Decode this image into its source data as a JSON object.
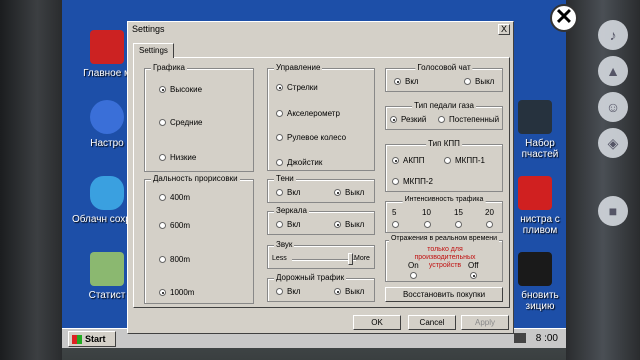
{
  "desktop_icons": [
    {
      "name": "home-icon",
      "label": "Главное м",
      "color": "#cc2222"
    },
    {
      "name": "settings-icon",
      "label": "Настро",
      "color": "#3a6fd8"
    },
    {
      "name": "cloud-save-icon",
      "label": "Облачн сохране",
      "color": "#3aa0e0"
    },
    {
      "name": "stats-icon",
      "label": "Статист",
      "color": "#8bb870"
    }
  ],
  "desktop_icons_right": [
    {
      "name": "parts-icon",
      "label": "Набор пчастей"
    },
    {
      "name": "fuel-icon",
      "label": "нистра с пливом"
    },
    {
      "name": "restore-icon",
      "label": "бновить зицию"
    }
  ],
  "taskbar": {
    "start": "Start",
    "clock": "8 :00"
  },
  "dialog": {
    "title": "Settings",
    "close": "X",
    "tab": "Settings",
    "graphics": {
      "title": "Графика",
      "options": [
        "Высокие",
        "Средние",
        "Низкие"
      ],
      "selected": 0
    },
    "draw_distance": {
      "title": "Дальность прорисовки",
      "options": [
        "400m",
        "600m",
        "800m",
        "1000m"
      ],
      "selected": 3
    },
    "control": {
      "title": "Управление",
      "options": [
        "Стрелки",
        "Акселерометр",
        "Рулевое колесо",
        "Джойстик"
      ],
      "selected": 0
    },
    "shadows": {
      "title": "Тени",
      "on": "Вкл",
      "off": "Выкл",
      "selected": "off"
    },
    "mirrors": {
      "title": "Зеркала",
      "on": "Вкл",
      "off": "Выкл",
      "selected": "off"
    },
    "sound": {
      "title": "Звук",
      "less": "Less",
      "more": "More",
      "level": 0.92
    },
    "traffic": {
      "title": "Дорожный трафик",
      "on": "Вкл",
      "off": "Выкл",
      "selected": "off"
    },
    "voice_chat": {
      "title": "Голосовой чат",
      "on": "Вкл",
      "off": "Выкл",
      "selected": "on"
    },
    "gas_pedal": {
      "title": "Тип педали газа",
      "options": [
        "Резкий",
        "Постепенный"
      ],
      "selected": 0
    },
    "gearbox": {
      "title": "Тип КПП",
      "options": [
        "АКПП",
        "МКПП-1",
        "МКПП-2"
      ],
      "selected": 0
    },
    "traffic_density": {
      "title": "Интенсивность трафика",
      "options": [
        "5",
        "10",
        "15",
        "20"
      ],
      "selected": -1
    },
    "reflections": {
      "title": "Отражения в реальном времени",
      "note": "только для производительных устройств",
      "on": "On",
      "off": "Off",
      "selected": "off"
    },
    "restore_button": "Восстановить покупки",
    "ok": "OK",
    "cancel": "Cancel",
    "apply": "Apply"
  }
}
